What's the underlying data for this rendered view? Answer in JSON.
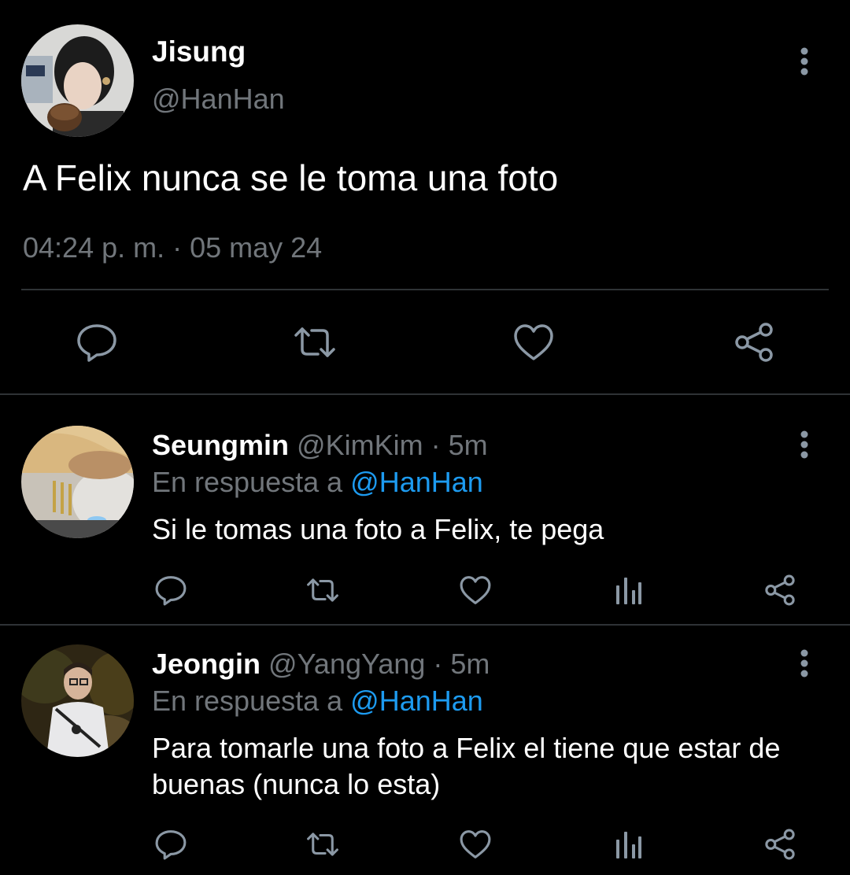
{
  "colors": {
    "background": "#000000",
    "text_primary": "#ffffff",
    "text_secondary": "#71767b",
    "link": "#1d9bf0",
    "divider": "#2f3336"
  },
  "main_tweet": {
    "author_name": "Jisung",
    "author_handle": "@HanHan",
    "text": "A Felix nunca se le toma una foto",
    "timestamp": "04:24 p. m. · 05 may 24",
    "avatar_icon": "avatar-photo",
    "more_icon": "more-vertical-icon",
    "actions": [
      "reply-icon",
      "retweet-icon",
      "like-icon",
      "share-icon"
    ]
  },
  "replies": [
    {
      "author_name": "Seungmin",
      "author_handle": "@KimKim",
      "time": "· 5m",
      "reply_prefix": "En respuesta a ",
      "reply_mention": "@HanHan",
      "text": "Si le tomas una foto a Felix, te pega",
      "actions": [
        "reply-icon",
        "retweet-icon",
        "like-icon",
        "views-icon",
        "share-icon"
      ]
    },
    {
      "author_name": "Jeongin",
      "author_handle": "@YangYang",
      "time": "· 5m",
      "reply_prefix": "En respuesta a ",
      "reply_mention": "@HanHan",
      "text": "Para tomarle una foto a Felix el tiene que estar de buenas (nunca lo esta)",
      "actions": [
        "reply-icon",
        "retweet-icon",
        "like-icon",
        "views-icon",
        "share-icon"
      ]
    }
  ]
}
